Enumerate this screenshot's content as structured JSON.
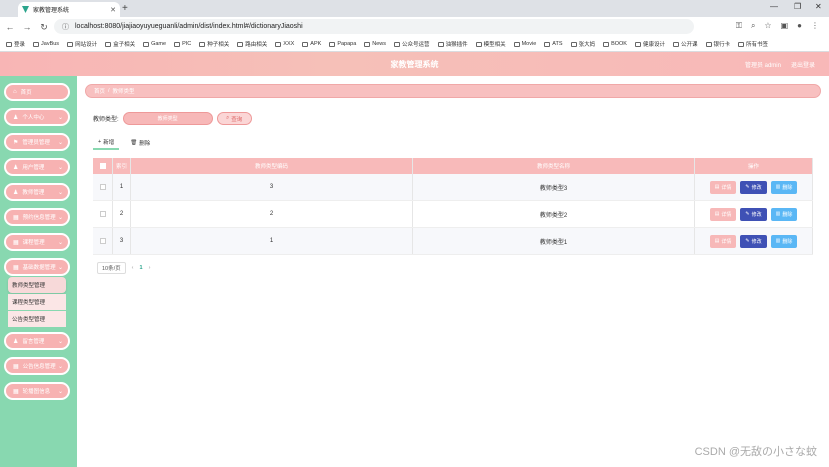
{
  "browser": {
    "tab_title": "家教管理系统",
    "url": "localhost:8080/jiajiaoyuyueguanli/admin/dist/index.html#/dictionaryJiaoshi",
    "bookmarks": [
      "登录",
      "JavBus",
      "网站设计",
      "盒子相关",
      "Game",
      "PIC",
      "种子相关",
      "路由相关",
      "XXX",
      "APK",
      "Papapa",
      "News",
      "公众号运营",
      "油猴插件",
      "模型相关",
      "Movie",
      "ATS",
      "张大妈",
      "BOOK",
      "健康设计",
      "公开课",
      "银行卡",
      "所有书签"
    ]
  },
  "header": {
    "title": "家教管理系统",
    "admin": "管理员 admin",
    "logout": "退出登录"
  },
  "sidebar": {
    "items": [
      {
        "label": "首页",
        "icon": "home-icon"
      },
      {
        "label": "个人中心",
        "icon": "user-icon"
      },
      {
        "label": "管理员管理",
        "icon": "flag-icon"
      },
      {
        "label": "用户管理",
        "icon": "user-icon"
      },
      {
        "label": "教师管理",
        "icon": "user-icon"
      },
      {
        "label": "预约信息管理",
        "icon": "grid-icon"
      },
      {
        "label": "课程管理",
        "icon": "grid-icon"
      },
      {
        "label": "基础数据管理",
        "icon": "grid-icon"
      },
      {
        "label": "留言管理",
        "icon": "user-icon"
      },
      {
        "label": "公告信息管理",
        "icon": "grid-icon"
      },
      {
        "label": "轮播图信息",
        "icon": "grid-icon"
      }
    ],
    "submenu": [
      "教师类型管理",
      "课程类型管理",
      "公告类型管理"
    ]
  },
  "breadcrumb": {
    "home": "首页",
    "sep": "/",
    "current": "教师类型"
  },
  "search": {
    "label": "教师类型",
    "placeholder": "教师类型",
    "button": "查询"
  },
  "actions": {
    "add": "新增",
    "delete": "删除"
  },
  "table": {
    "headers": [
      "索引",
      "教师类型编码",
      "教师类型名称",
      "操作"
    ],
    "rows": [
      {
        "index": "1",
        "code": "3",
        "name": "教师类型3"
      },
      {
        "index": "2",
        "code": "2",
        "name": "教师类型2"
      },
      {
        "index": "3",
        "code": "1",
        "name": "教师类型1"
      }
    ],
    "ops": {
      "detail": "详情",
      "edit": "修改",
      "remove": "删除"
    }
  },
  "pager": {
    "size": "10条/页",
    "page": "1"
  },
  "watermark": "CSDN @无敌の小さな蚊"
}
